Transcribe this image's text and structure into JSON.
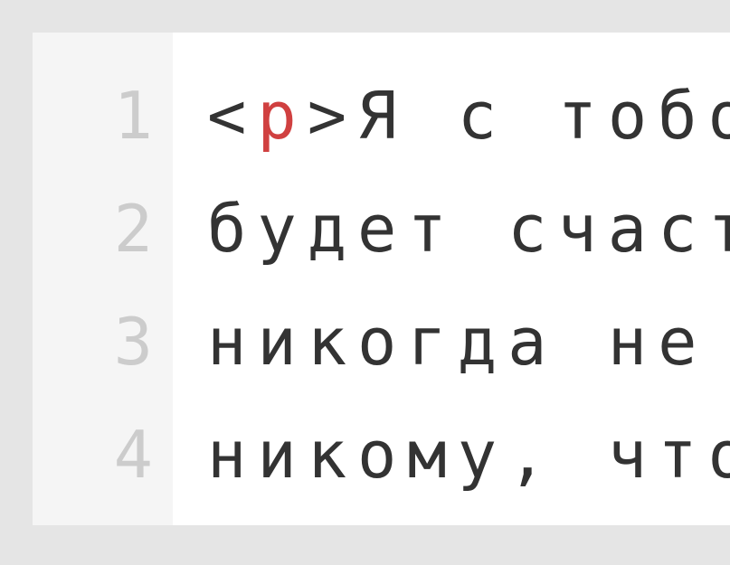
{
  "editor": {
    "gutter": {
      "line_numbers": [
        "1",
        "2",
        "3",
        "4"
      ]
    },
    "code": {
      "lines": [
        {
          "segments": [
            {
              "type": "bracket",
              "text": "<"
            },
            {
              "type": "tagname",
              "text": "p"
            },
            {
              "type": "bracket",
              "text": ">"
            },
            {
              "type": "text",
              "text": "Я с тобо"
            }
          ]
        },
        {
          "segments": [
            {
              "type": "text",
              "text": "будет счаст"
            }
          ]
        },
        {
          "segments": [
            {
              "type": "text",
              "text": "никогда не "
            }
          ]
        },
        {
          "segments": [
            {
              "type": "text",
              "text": "никому, что"
            }
          ]
        }
      ]
    }
  }
}
